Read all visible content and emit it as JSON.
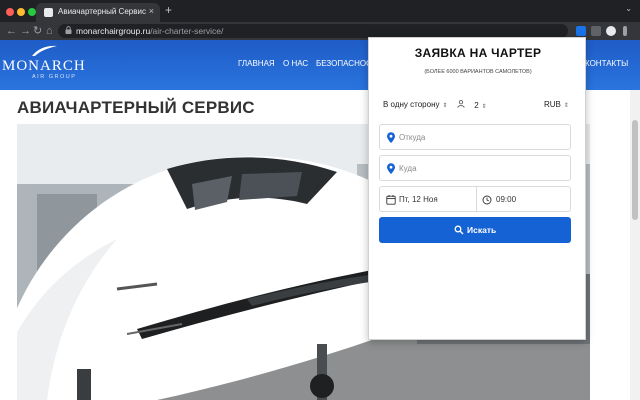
{
  "browser": {
    "tab_title": "Авиачартерный Сервис",
    "tab_close": "×",
    "new_tab": "+",
    "tab_menu": "⌄",
    "back": "←",
    "forward": "→",
    "reload": "↻",
    "home": "⌂",
    "url_host": "monarchairgroup.ru",
    "url_path": "/air-charter-service/"
  },
  "site": {
    "logo": "MONARCH",
    "logo_sub": "AIR GROUP",
    "nav": [
      "ГЛАВНАЯ",
      "О НАС",
      "БЕЗОПАСНОСТ",
      "КОНТАКТЫ"
    ],
    "page_title": "АВИАЧАРТЕРНЫЙ СЕРВИС",
    "brand_color": "#2366d1"
  },
  "popup": {
    "title": "ЗАЯВКА НА ЧАРТЕР",
    "subtitle": "(БОЛЕЕ 6000 ВАРИАНТОВ САМОЛЕТОВ)",
    "trip_type": "В одну сторону",
    "passengers": "2",
    "currency": "RUB",
    "from_placeholder": "Откуда",
    "to_placeholder": "Куда",
    "date": "Пт, 12 Ноя",
    "time": "09:00",
    "submit": "Искать",
    "accent_color": "#1462d3"
  }
}
